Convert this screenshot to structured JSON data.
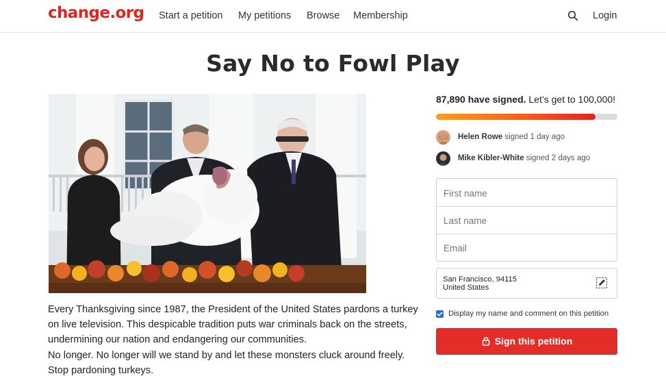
{
  "header": {
    "logo": "change.org",
    "nav": [
      "Start a petition",
      "My petitions",
      "Browse",
      "Membership"
    ],
    "login": "Login"
  },
  "petition": {
    "title": "Say No to Fowl Play",
    "description": [
      "Every Thanksgiving since 1987, the President of the United States pardons a turkey on live television. This despicable tradition puts war criminals back on the streets, undermining our nation and endangering our communities.",
      "No longer. No longer will we stand by and let these monsters cluck around freely. Stop pardoning turkeys."
    ]
  },
  "signatures": {
    "count": "87,890 have signed.",
    "goal_text": "Let’s get to 100,000!",
    "progress": 0.879
  },
  "recent_signers": [
    {
      "name": "Helen Rowe",
      "action": "signed 1 day ago"
    },
    {
      "name": "Mike Kibler-White",
      "action": "signed 2 days ago"
    }
  ],
  "form": {
    "first_name_placeholder": "First name",
    "last_name_placeholder": "Last name",
    "email_placeholder": "Email",
    "location_city": "San Francisco, 94115",
    "location_country": "United States",
    "display_checkbox_label": "Display my name and comment on this petition",
    "display_checked": true,
    "submit_label": "Sign this petition"
  },
  "colors": {
    "brand_red": "#e0241f",
    "button_red": "#e42c28",
    "checkbox_blue": "#1d6fe0"
  },
  "icons": [
    "search-icon",
    "edit-location-icon",
    "lock-icon"
  ]
}
